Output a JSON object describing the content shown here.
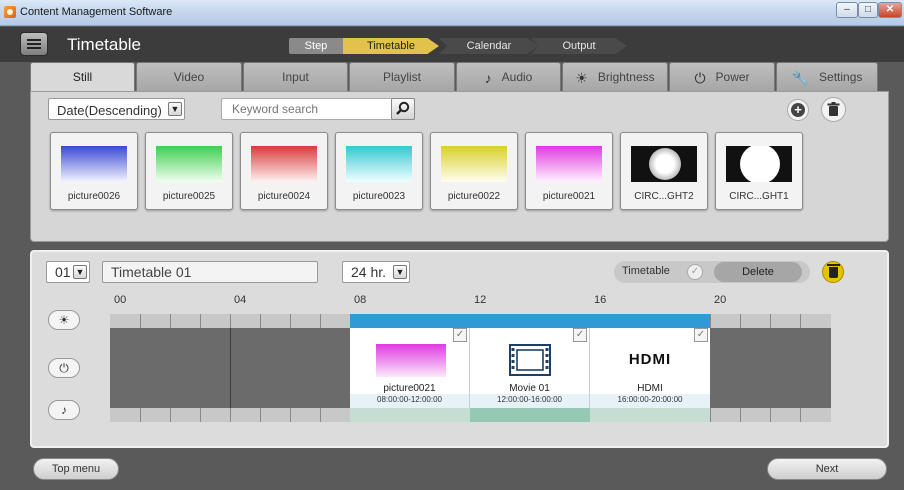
{
  "window": {
    "title": "Content Management Software",
    "controls": [
      "–",
      "□",
      "✕"
    ]
  },
  "header": {
    "title": "Timetable"
  },
  "steps": {
    "label": "Step",
    "items": [
      "Timetable",
      "Calendar",
      "Output"
    ],
    "active": "Timetable"
  },
  "tabs": [
    {
      "label": "Still",
      "icon": ""
    },
    {
      "label": "Video",
      "icon": ""
    },
    {
      "label": "Input",
      "icon": ""
    },
    {
      "label": "Playlist",
      "icon": ""
    },
    {
      "label": "Audio",
      "icon": "♪"
    },
    {
      "label": "Brightness",
      "icon": "☀"
    },
    {
      "label": "Power",
      "icon": "⏻"
    },
    {
      "label": "Settings",
      "icon": "🔧"
    }
  ],
  "content": {
    "sort": "Date(Descending)",
    "search_placeholder": "Keyword search",
    "thumbnails": [
      {
        "caption": "picture0026",
        "color": "#3a49d4"
      },
      {
        "caption": "picture0025",
        "color": "#3fcf4d"
      },
      {
        "caption": "picture0024",
        "color": "#d93a3a"
      },
      {
        "caption": "picture0023",
        "color": "#35c8d2"
      },
      {
        "caption": "picture0022",
        "color": "#d9cf2b"
      },
      {
        "caption": "picture0021",
        "color": "#e03ae0"
      },
      {
        "caption": "CIRC...GHT2",
        "color": "#111111"
      },
      {
        "caption": "CIRC...GHT1",
        "color": "#111111"
      }
    ]
  },
  "timetable": {
    "number": "01",
    "name": "Timetable 01",
    "range": "24 hr.",
    "toggle_label": "Timetable",
    "delete_label": "Delete",
    "hours": [
      "00",
      "04",
      "08",
      "12",
      "16",
      "20"
    ],
    "blocks": [
      {
        "name": "picture0021",
        "time": "08:00:00-12:00:00",
        "kind": "image"
      },
      {
        "name": "Movie 01",
        "time": "12:00:00-16:00:00",
        "kind": "movie"
      },
      {
        "name": "HDMI",
        "time": "16:00:00-20:00:00",
        "kind": "hdmi",
        "icon_text": "HDMI"
      }
    ],
    "side_icons": [
      "sun-icon",
      "power-icon",
      "note-icon"
    ]
  },
  "footer": {
    "top_menu": "Top menu",
    "next": "Next"
  }
}
